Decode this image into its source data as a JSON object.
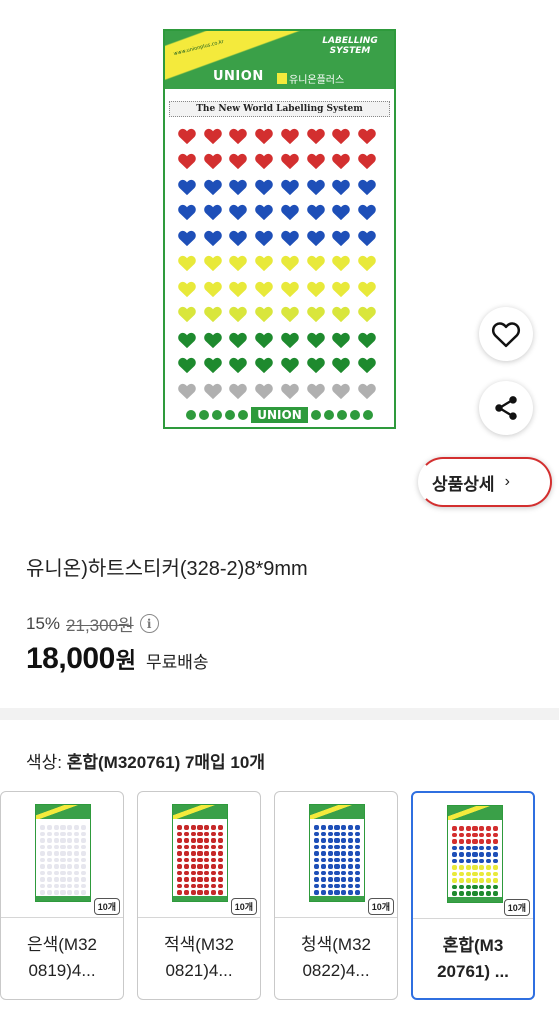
{
  "product_image": {
    "brand_tagline": "LABELLING SYSTEM",
    "brand_url": "www.unionplus.co.kr",
    "brand_name": "UNION",
    "brand_name_kr": "유니온플러스",
    "sheet_title": "The New World Labelling System",
    "footer_brand": "UNION",
    "heart_rows": [
      "#d32f2f",
      "#d32f2f",
      "#1e4fb8",
      "#1e4fb8",
      "#1e4fb8",
      "#e8e93a",
      "#e8e93a",
      "#d9e63c",
      "#1e8a2e",
      "#1e8a2e",
      "#b0b0b0"
    ]
  },
  "actions": {
    "like_icon": "heart-outline-icon",
    "share_icon": "share-icon",
    "detail_label": "상품상세",
    "detail_chevron": "›"
  },
  "product": {
    "title": "유니온)하트스티커(328-2)8*9mm",
    "discount_rate": "15%",
    "original_price": "21,300원",
    "price": "18,000",
    "price_unit": "원",
    "shipping": "무료배송"
  },
  "option": {
    "label": "색상: ",
    "selected_value": "혼합(M320761) 7매입 10개",
    "items": [
      {
        "name_line1": "은색(M32",
        "name_line2": "0819)4...",
        "qty": "10개",
        "swatch": [
          "#e6e6ee"
        ],
        "selected": false
      },
      {
        "name_line1": "적색(M32",
        "name_line2": "0821)4...",
        "qty": "10개",
        "swatch": [
          "#c62828"
        ],
        "selected": false
      },
      {
        "name_line1": "청색(M32",
        "name_line2": "0822)4...",
        "qty": "10개",
        "swatch": [
          "#1e4fb8"
        ],
        "selected": false
      },
      {
        "name_line1": "혼합(M3",
        "name_line2": "20761) ...",
        "qty": "10개",
        "swatch": [
          "#d32f2f",
          "#1e4fb8",
          "#e8e93a",
          "#1e8a2e"
        ],
        "selected": true
      }
    ]
  },
  "colors": {
    "accent_blue": "#2f6fe0",
    "highlight_red": "#d32f2f",
    "brand_green": "#3aa048"
  }
}
